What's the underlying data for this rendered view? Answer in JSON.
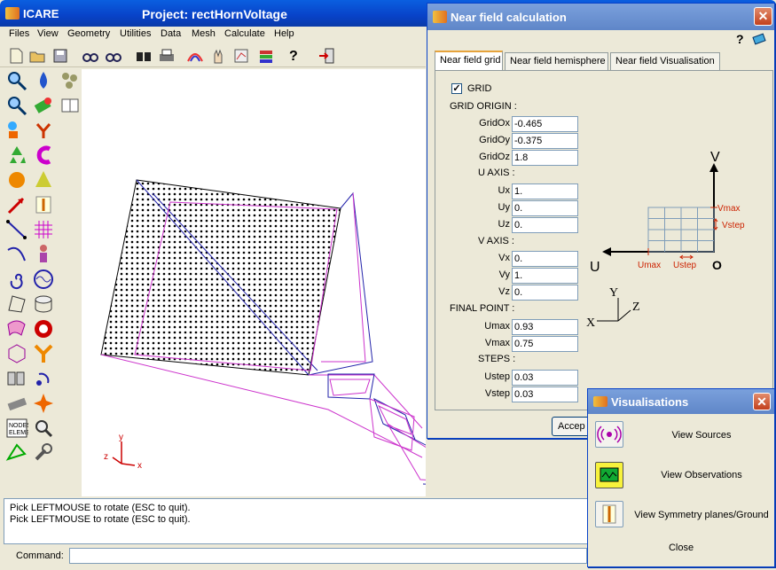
{
  "app": {
    "name": "ICARE",
    "title": "Project: rectHornVoltage"
  },
  "menu": [
    "Files",
    "View",
    "Geometry",
    "Utilities",
    "Data",
    "Mesh",
    "Calculate",
    "Help"
  ],
  "console": {
    "lines": [
      "Pick LEFTMOUSE to rotate (ESC to quit).",
      "Pick LEFTMOUSE to rotate (ESC to quit)."
    ],
    "command_label": "Command:",
    "command_value": ""
  },
  "canvas_axes": {
    "y": "y",
    "z": "z",
    "x": "x"
  },
  "nearfield": {
    "title": "Near field calculation",
    "help_icon": "?",
    "tabs": [
      "Near field grid",
      "Near field hemisphere",
      "Near field Visualisation"
    ],
    "grid_checkbox": "GRID",
    "grid_origin": "GRID ORIGIN :",
    "gridox": {
      "label": "GridOx",
      "value": "-0.465"
    },
    "gridoy": {
      "label": "GridOy",
      "value": "-0.375"
    },
    "gridoz": {
      "label": "GridOz",
      "value": "1.8"
    },
    "u_axis": "U AXIS :",
    "ux": {
      "label": "Ux",
      "value": "1."
    },
    "uy": {
      "label": "Uy",
      "value": "0."
    },
    "uz": {
      "label": "Uz",
      "value": "0."
    },
    "v_axis": "V AXIS :",
    "vx": {
      "label": "Vx",
      "value": "0."
    },
    "vy": {
      "label": "Vy",
      "value": "1."
    },
    "vz": {
      "label": "Vz",
      "value": "0."
    },
    "final_point": "FINAL POINT :",
    "umax": {
      "label": "Umax",
      "value": "0.93"
    },
    "vmax": {
      "label": "Vmax",
      "value": "0.75"
    },
    "steps": "STEPS :",
    "ustep": {
      "label": "Ustep",
      "value": "0.03"
    },
    "vstep": {
      "label": "Vstep",
      "value": "0.03"
    },
    "accept": "Accep",
    "diagram": {
      "V": "V",
      "U": "U",
      "O": "O",
      "Vmax": "Vmax",
      "Vstep": "Vstep",
      "Umax": "Umax",
      "Ustep": "Ustep",
      "X": "X",
      "Y": "Y",
      "Z": "Z"
    }
  },
  "visualisations": {
    "title": "Visualisations",
    "items": [
      "View Sources",
      "View Observations",
      "View Symmetry planes/Ground"
    ],
    "close": "Close"
  },
  "colors": {
    "titlebar": "#0a5fe0",
    "mesh": "#cc33cc",
    "wire": "#2222aa",
    "diagram_red": "#cc2200"
  }
}
